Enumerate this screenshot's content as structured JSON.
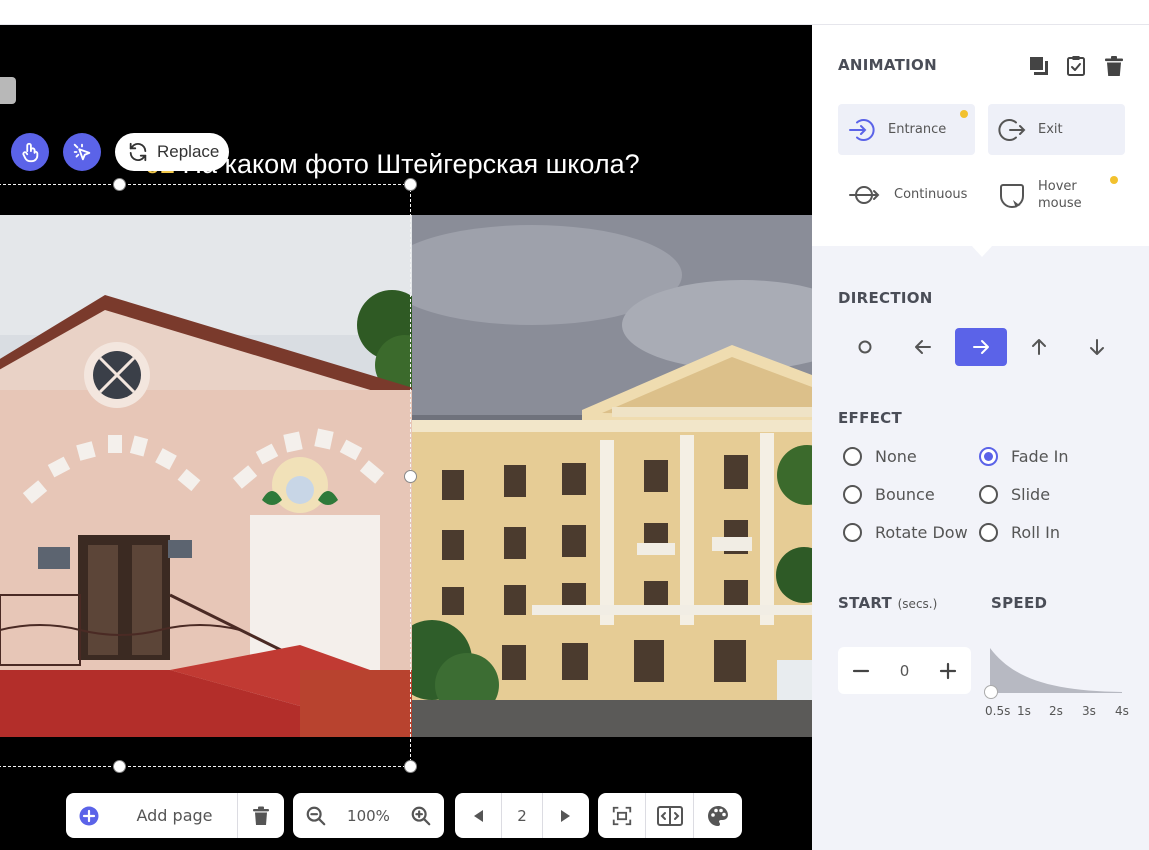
{
  "canvas": {
    "question_number": "02",
    "question_text": " На каком фото Штейгерская школа?",
    "replace_label": "Replace"
  },
  "toolbar": {
    "add_page_label": "Add page",
    "zoom_value": "100%",
    "page_number": "2"
  },
  "panel": {
    "animation_heading": "ANIMATION",
    "animation_types": [
      {
        "label": "Entrance",
        "active": true,
        "has_badge": true
      },
      {
        "label": "Exit",
        "active": false,
        "has_badge": false
      },
      {
        "label": "Continuous",
        "active": false,
        "has_badge": false
      },
      {
        "label": "Hover mouse",
        "active": false,
        "has_badge": true
      }
    ],
    "direction_heading": "DIRECTION",
    "direction_selected": "right",
    "effect_heading": "EFFECT",
    "effects": [
      {
        "label": "None",
        "selected": false
      },
      {
        "label": "Fade In",
        "selected": true
      },
      {
        "label": "Bounce",
        "selected": false
      },
      {
        "label": "Slide",
        "selected": false
      },
      {
        "label": "Rotate Down",
        "selected": false
      },
      {
        "label": "Roll In",
        "selected": false
      }
    ],
    "start_heading": "START",
    "start_unit": "(secs.)",
    "start_value": "0",
    "speed_heading": "SPEED",
    "speed_ticks": [
      "0.5s",
      "1s",
      "2s",
      "3s",
      "4s"
    ],
    "speed_selected": "0.5s"
  },
  "colors": {
    "accent": "#5b63e8",
    "badge": "#f2c12e",
    "panel_bg": "#f2f3f9"
  }
}
